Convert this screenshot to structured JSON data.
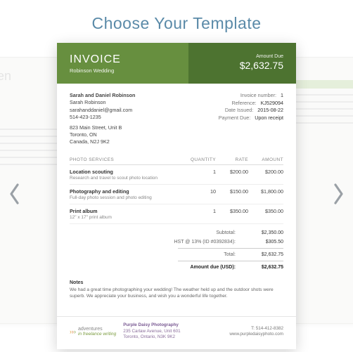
{
  "heading": "Choose Your Template",
  "invoice": {
    "title": "INVOICE",
    "subtitle": "Robinson Wedding",
    "amount_due_label": "Amount Due",
    "amount_due": "$2,632.75",
    "bill_to": {
      "name": "Sarah and Daniel Robinson",
      "attn": "Sarah Robinson",
      "email": "sarahanddaniel@gmail.com",
      "phone": "514-423-1235",
      "address1": "823 Main Street, Unit B",
      "address2": "Toronto, ON",
      "address3": "Canada, N2J 9K2"
    },
    "meta": {
      "invoice_number_label": "Invoice number:",
      "invoice_number": "1",
      "reference_label": "Reference:",
      "reference": "KJ529094",
      "date_issued_label": "Date Issued:",
      "date_issued": "2015-08-22",
      "payment_due_label": "Payment Due:",
      "payment_due": "Upon receipt"
    },
    "columns": {
      "services": "PHOTO SERVICES",
      "qty": "QUANTITY",
      "rate": "RATE",
      "amount": "AMOUNT"
    },
    "items": [
      {
        "name": "Location scouting",
        "detail": "Research and travel to scout photo location",
        "qty": "1",
        "rate": "$200.00",
        "amount": "$200.00"
      },
      {
        "name": "Photography and editing",
        "detail": "Full-day photo session and photo editing",
        "qty": "10",
        "rate": "$150.00",
        "amount": "$1,800.00"
      },
      {
        "name": "Print album",
        "detail": "12\" x 17\" print album",
        "qty": "1",
        "rate": "$350.00",
        "amount": "$350.00"
      }
    ],
    "totals": {
      "subtotal_label": "Subtotal:",
      "subtotal": "$2,350.00",
      "tax_label": "HST @ 13% (ID #0392834):",
      "tax": "$305.50",
      "total_label": "Total:",
      "total": "$2,632.75",
      "due_label": "Amount due (USD):",
      "due": "$2,632.75"
    },
    "notes": {
      "title": "Notes",
      "body": "We had a great time photographing your wedding! The weather held up and the outdoor shots were superb. We appreciate your business, and wish you a wonderful life together."
    },
    "footer": {
      "brand1": "adventures",
      "brand2": "in freelance writing",
      "company": "Purple Daisy Photography",
      "addr1": "235 Carlaw Avenue, Unit 601",
      "addr2": "Toronto, Ontario, N3K 9K2",
      "phone": "T: 514-412-8382",
      "web": "www.purpledaisyphoto.com"
    }
  },
  "colors": {
    "header_left": "#678f3f",
    "header_right": "#4d7330",
    "heading_text": "#5a8aa8"
  }
}
